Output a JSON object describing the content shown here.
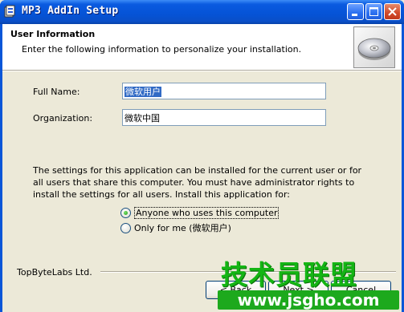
{
  "window": {
    "title": "MP3 AddIn Setup"
  },
  "header": {
    "title": "User Information",
    "subtitle": "Enter the following information to personalize your installation."
  },
  "form": {
    "full_name_label": "Full Name:",
    "full_name_value": "微软用户",
    "organization_label": "Organization:",
    "organization_value": "微软中国"
  },
  "description": "The settings for this application can be installed for the current user or for all users that share this computer. You must have administrator rights to install the settings for all users. Install this application for:",
  "options": {
    "anyone_label": "Anyone who uses this computer",
    "only_me_label": "Only for me (微软用户)",
    "selected": "anyone"
  },
  "footer": {
    "brand": "TopByteLabs Ltd.",
    "back_label": "< Back",
    "next_label": "Next >",
    "cancel_label": "Cancel"
  },
  "watermark": {
    "text_cn": "技术员联盟",
    "url": "www.jsgho.com"
  },
  "colors": {
    "titlebar": "#0a5ae0",
    "dialog_bg": "#ece9d8",
    "selection": "#316ac5",
    "watermark_green": "#1da91d"
  }
}
